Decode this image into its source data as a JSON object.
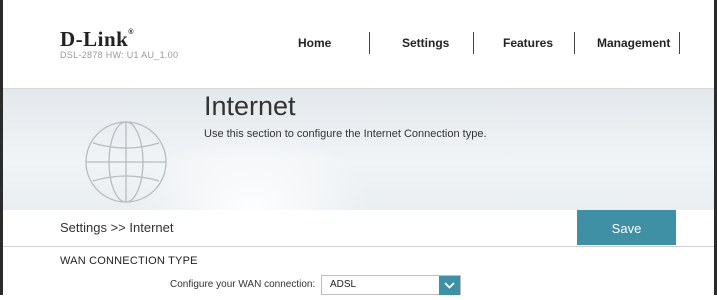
{
  "brand": {
    "logo": "D-Link",
    "trademark": "®",
    "model_info": "DSL-2878  HW: U1  AU_1.00"
  },
  "nav": {
    "items": [
      {
        "label": "Home"
      },
      {
        "label": "Settings"
      },
      {
        "label": "Features"
      },
      {
        "label": "Management"
      }
    ]
  },
  "banner": {
    "title": "Internet",
    "description": "Use this section to configure the Internet Connection type.",
    "icon": "globe-icon"
  },
  "breadcrumb": {
    "text": "Settings >> Internet"
  },
  "toolbar": {
    "save_label": "Save"
  },
  "wan": {
    "section_title": "WAN CONNECTION TYPE",
    "field_label": "Configure your WAN connection:",
    "selected_value": "ADSL"
  },
  "colors": {
    "accent": "#3f8fa5",
    "frame": "#2b2b2b"
  }
}
